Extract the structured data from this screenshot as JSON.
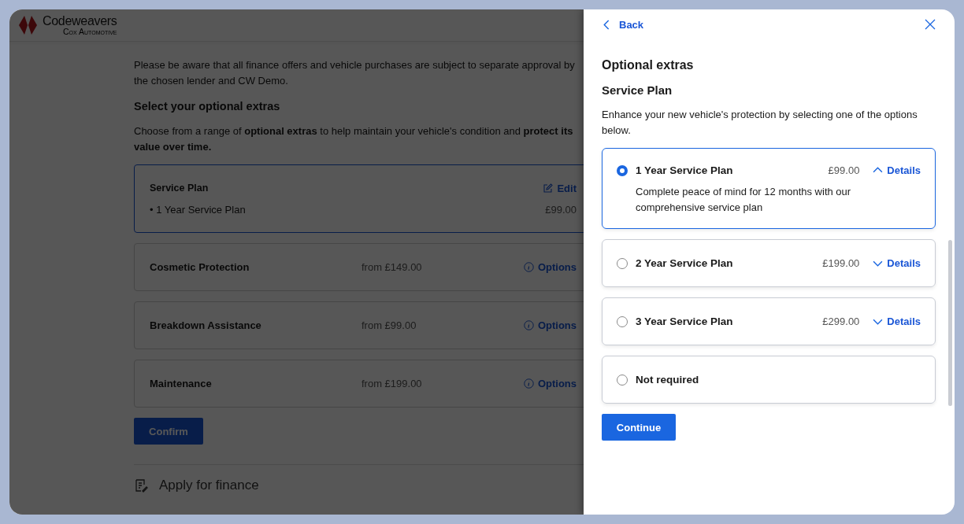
{
  "header": {
    "logo": {
      "name": "Codeweavers",
      "tagline": "Cox Automotive"
    }
  },
  "page": {
    "notice": "Please be aware that all finance offers and vehicle purchases are subject to separate approval by the chosen lender and CW Demo.",
    "heading": "Select your optional extras",
    "intro": "Choose from a range of **optional extras** to help maintain your vehicle's condition and **protect its value over time.**",
    "selected_extra": {
      "title": "Service Plan",
      "action": "Edit",
      "items": [
        {
          "label": "• 1 Year Service Plan",
          "price": "£99.00"
        }
      ]
    },
    "extras": [
      {
        "name": "Cosmetic Protection",
        "price": "from £149.00",
        "action": "Options"
      },
      {
        "name": "Breakdown Assistance",
        "price": "from £99.00",
        "action": "Options"
      },
      {
        "name": "Maintenance",
        "price": "from £199.00",
        "action": "Options"
      }
    ],
    "confirm_button": "Confirm",
    "next_section": "Apply for finance"
  },
  "drawer": {
    "back": "Back",
    "title": "Optional extras",
    "subtitle": "Service Plan",
    "description": "Enhance your new vehicle's protection by selecting one of the options below.",
    "options": [
      {
        "name": "1 Year Service Plan",
        "price": "£99.00",
        "details": "Details",
        "expanded": true,
        "selected": true,
        "description": "Complete peace of mind for 12 months with our comprehensive service plan"
      },
      {
        "name": "2 Year Service Plan",
        "price": "£199.00",
        "details": "Details",
        "expanded": false,
        "selected": false
      },
      {
        "name": "3 Year Service Plan",
        "price": "£299.00",
        "details": "Details",
        "expanded": false,
        "selected": false
      },
      {
        "name": "Not required",
        "selected": false
      }
    ],
    "continue_button": "Continue"
  }
}
